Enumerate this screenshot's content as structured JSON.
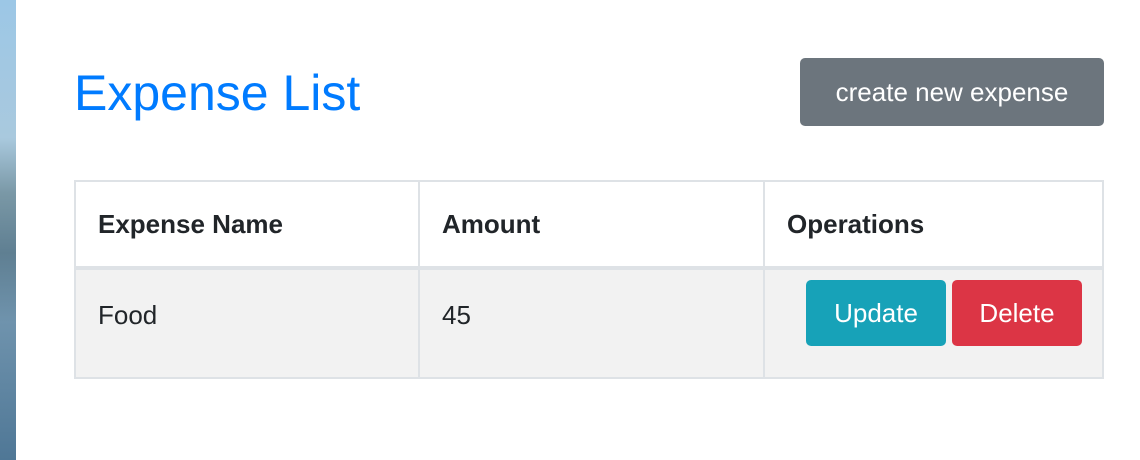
{
  "header": {
    "title": "Expense List",
    "create_button_label": "create new expense"
  },
  "table": {
    "columns": [
      "Expense Name",
      "Amount",
      "Operations"
    ],
    "rows": [
      {
        "name": "Food",
        "amount": "45",
        "update_label": "Update",
        "delete_label": "Delete"
      }
    ]
  },
  "colors": {
    "title": "#007bff",
    "secondary_button": "#6c757d",
    "update_button": "#17a2b8",
    "delete_button": "#dc3545",
    "row_background": "#f2f2f2"
  }
}
